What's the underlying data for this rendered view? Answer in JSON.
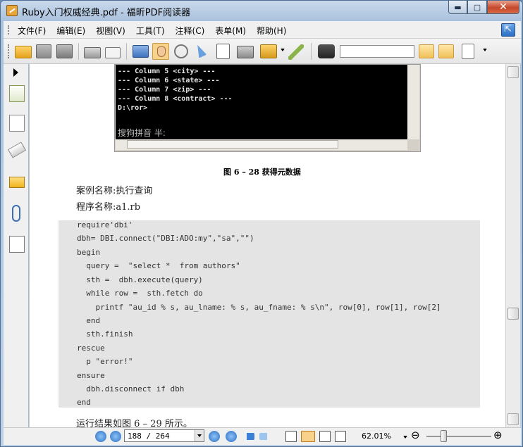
{
  "window": {
    "title": "Ruby入门权威经典.pdf - 福昕PDF阅读器",
    "minimize_glyph": "▬",
    "maximize_glyph": "▢",
    "close_glyph": "✕"
  },
  "menu": {
    "items": [
      "文件(F)",
      "编辑(E)",
      "视图(V)",
      "工具(T)",
      "注释(C)",
      "表单(M)",
      "帮助(H)"
    ]
  },
  "toolbar": {
    "search_value": "",
    "icons": [
      "open-folder-icon",
      "save-icon",
      "save-all-icon",
      "print-icon",
      "email-icon",
      "fullscreen-icon",
      "hand-tool-icon",
      "zoom-tool-icon",
      "select-arrow-icon",
      "text-select-icon",
      "snapshot-icon",
      "rms-icon",
      "typewriter-icon",
      "binoculars-icon",
      "find-prev-icon",
      "find-next-icon",
      "highlight-icon"
    ]
  },
  "document": {
    "terminal_lines": [
      "--- Column 5 <city> ---",
      "--- Column 6 <state> ---",
      "--- Column 7 <zip> ---",
      "--- Column 8 <contract> ---",
      "",
      "D:\\ror>"
    ],
    "terminal_ime": "搜狗拼音 半:",
    "figure_caption": "图 6 – 28   获得元数据",
    "case_name": "案例名称:执行查询",
    "program_name": "程序名称:a1.rb",
    "code": [
      "require'dbi'",
      "dbh= DBI.connect(\"DBI:ADO:my\",\"sa\",\"\")",
      "begin",
      "  query =  \"select *  from authors\"",
      "  sth =  dbh.execute(query)",
      "  while row =  sth.fetch do",
      "    printf \"au_id % s, au_lname: % s, au_fname: % s\\n\", row[0], row[1], row[2]",
      "  end",
      "  sth.finish",
      "rescue",
      "  p \"error!\"",
      "ensure",
      "  dbh.disconnect if dbh",
      "end"
    ],
    "after_text": "运行结果如图 6 – 29 所示。"
  },
  "status": {
    "page_value": "188 / 264",
    "zoom_value": "62.01%",
    "zoom_out_glyph": "⊖",
    "zoom_in_glyph": "⊕"
  },
  "colors": {
    "accent": "#2d6fc4",
    "code_bg": "#e4e4e4",
    "terminal_bg": "#000000"
  }
}
